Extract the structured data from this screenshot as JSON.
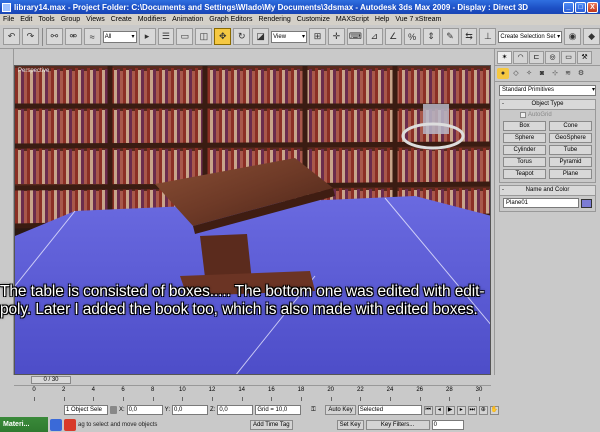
{
  "window": {
    "title": "library14.max   - Project Folder: C:\\Documents and Settings\\Wlado\\My Documents\\3dsmax   - Autodesk 3ds Max  2009      - Display : Direct 3D",
    "minimize": "_",
    "maximize": "□",
    "close": "X"
  },
  "menu": [
    "File",
    "Edit",
    "Tools",
    "Group",
    "Views",
    "Create",
    "Modifiers",
    "Animation",
    "Graph Editors",
    "Rendering",
    "Customize",
    "MAXScript",
    "Help",
    "Vue 7 xStream"
  ],
  "toolbar": {
    "selection_filter": "All",
    "ref_coord": "View",
    "named_selection_placeholder": "Create Selection Set"
  },
  "viewport": {
    "label": "Perspective",
    "caption": "The table is consisted of boxes..... The bottom one was edited with edit-poly. Later I added the book too, which is also made with edited boxes."
  },
  "command_panel": {
    "category": "Standard Primitives",
    "object_type_title": "Object Type",
    "autogrid": "AutoGrid",
    "primitives": [
      "Box",
      "Cone",
      "Sphere",
      "GeoSphere",
      "Cylinder",
      "Tube",
      "Torus",
      "Pyramid",
      "Teapot",
      "Plane"
    ],
    "name_color_title": "Name and Color",
    "object_name": "Plane01",
    "object_color": "#7b7bd4"
  },
  "time_slider": {
    "position": "0 / 30",
    "ticks": [
      "0",
      "2",
      "4",
      "6",
      "8",
      "10",
      "12",
      "14",
      "16",
      "18",
      "20",
      "22",
      "24",
      "26",
      "28",
      "30"
    ]
  },
  "status": {
    "selection": "1 Object Sele",
    "x_label": "X:",
    "x_value": "0,0",
    "y_label": "Y:",
    "y_value": "0,0",
    "z_label": "Z:",
    "z_value": "0,0",
    "grid": "Grid = 10,0",
    "auto_key": "Auto Key",
    "selected": "Selected",
    "set_key": "Set Key",
    "key_filters": "Key Filters...",
    "prompt": "ag to select and move objects",
    "add_time_tag": "Add Time Tag",
    "taskbar_app": "Materi...",
    "frame": "0"
  }
}
